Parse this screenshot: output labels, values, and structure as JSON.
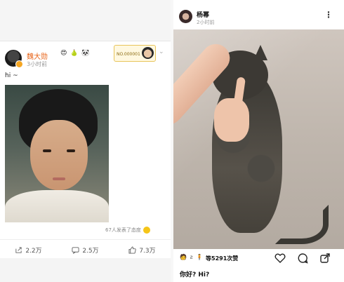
{
  "left_post": {
    "author": "魏大勋",
    "emojis": "😍 🍐 🐼",
    "time": "3小时前",
    "fan_badge": "NO.000001",
    "text": "hi ~",
    "reactions": "67人发表了态度",
    "actions": [
      {
        "icon": "share-icon",
        "label": "2.2万"
      },
      {
        "icon": "comment-icon",
        "label": "2.5万"
      },
      {
        "icon": "like-icon",
        "label": "7.3万"
      }
    ]
  },
  "right_post": {
    "author": "杨幂",
    "time": "2小时前",
    "more": "⋮",
    "likes_avatars": "🧑 ƨ 🧍",
    "likes": "等5291次赞",
    "caption": "你好? Hi?"
  },
  "colors": {
    "weibo_name": "#e8651a",
    "divider": "#f7f7f7"
  }
}
